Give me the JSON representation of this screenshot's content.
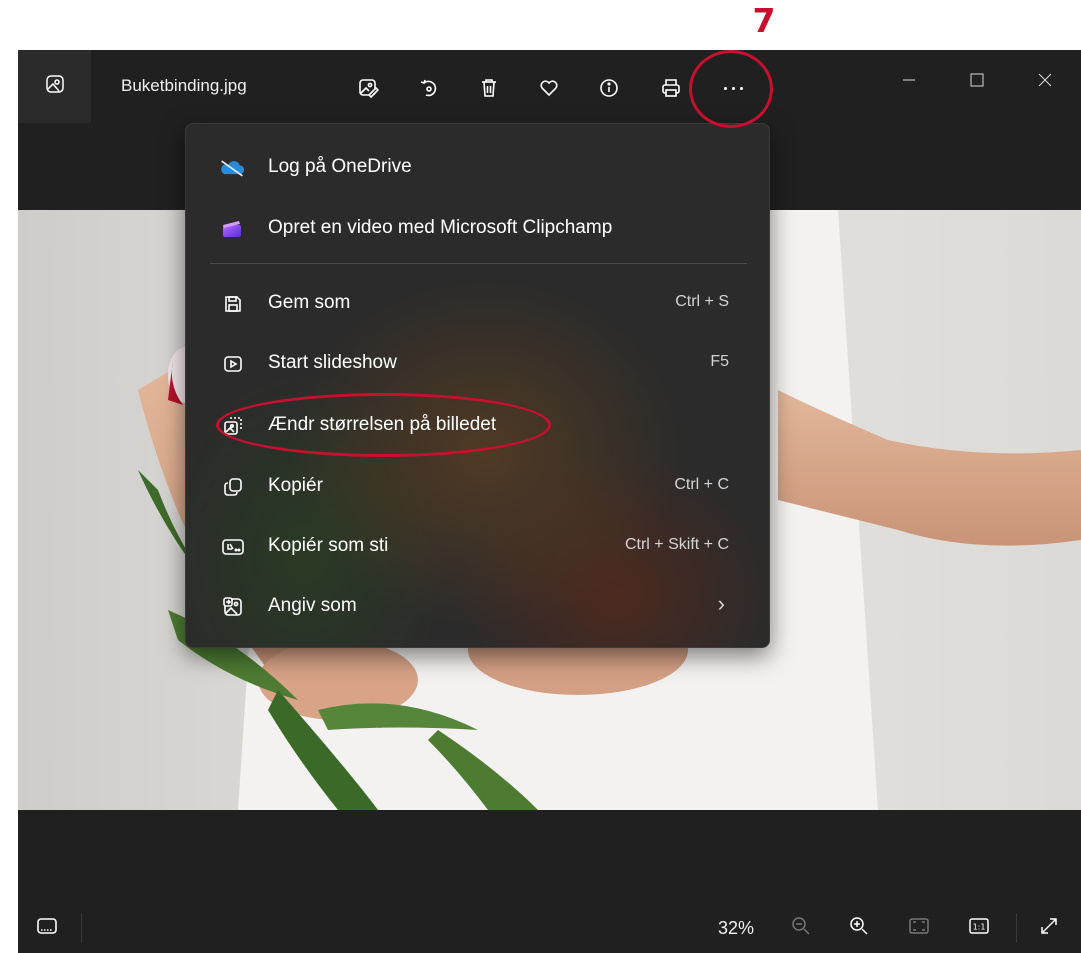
{
  "annotation": {
    "step_number": "7",
    "color": "#c8102e"
  },
  "titlebar": {
    "filename": "Buketbinding.jpg",
    "icons": [
      "gallery-icon",
      "edit-image-icon",
      "rotate-icon",
      "delete-icon",
      "favorite-icon",
      "info-icon",
      "print-icon",
      "more-icon",
      "minimize-icon",
      "maximize-icon",
      "close-icon"
    ]
  },
  "menu": {
    "items": [
      {
        "label": "Log på OneDrive",
        "shortcut": "",
        "icon": "onedrive-icon"
      },
      {
        "label": "Opret en video med Microsoft Clipchamp",
        "shortcut": "",
        "icon": "clipchamp-icon"
      },
      {
        "label": "Gem som",
        "shortcut": "Ctrl + S",
        "icon": "save-icon"
      },
      {
        "label": "Start slideshow",
        "shortcut": "F5",
        "icon": "slideshow-icon"
      },
      {
        "label": "Ændr størrelsen på billedet",
        "shortcut": "",
        "icon": "resize-icon"
      },
      {
        "label": "Kopiér",
        "shortcut": "Ctrl + C",
        "icon": "copy-icon"
      },
      {
        "label": "Kopiér som sti",
        "shortcut": "Ctrl + Skift + C",
        "icon": "copy-path-icon"
      },
      {
        "label": "Angiv som",
        "shortcut": "",
        "icon": "set-as-icon",
        "submenu": true
      }
    ]
  },
  "bottombar": {
    "zoom": "32%",
    "icons": [
      "filmstrip-icon",
      "zoom-out-icon",
      "zoom-in-icon",
      "fit-icon",
      "actual-size-icon",
      "fullscreen-icon"
    ]
  }
}
